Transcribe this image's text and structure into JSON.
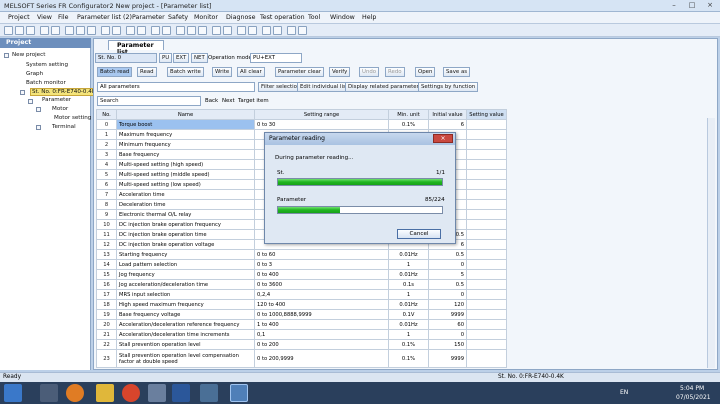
{
  "window": {
    "title": "MELSOFT Series FR Configurator2 New project - [Parameter list]"
  },
  "menu": [
    "Project",
    "View",
    "File",
    "Parameter list (2)",
    "Parameter",
    "Safety",
    "Monitor",
    "Diagnose",
    "Test operation",
    "Tool",
    "Window",
    "Help"
  ],
  "project_pane": {
    "title": "Project",
    "tree": [
      "New project",
      "System setting",
      "Graph",
      "Batch monitor",
      "St. No. 0:FR-E740-0.4K",
      "Parameter",
      "Motor",
      "Motor setting",
      "Terminal"
    ]
  },
  "param_window": {
    "tab": "Parameter list",
    "station": "St. No. 0",
    "mode_buttons": [
      "PU",
      "EXT",
      "NET"
    ],
    "operation_mode_label": "Operation mode",
    "operation_mode_value": "PU+EXT",
    "actions": [
      "Batch read",
      "Read",
      "Batch write",
      "Write",
      "All clear",
      "Parameter clear",
      "Verify",
      "Undo",
      "Redo",
      "Open",
      "Save as"
    ],
    "filter_value": "All parameters",
    "filter_buttons": [
      "Filter selection",
      "Edit individual list",
      "Display related parameters",
      "Settings by function"
    ],
    "search_button": "Search",
    "nav_buttons": [
      "Back",
      "Next",
      "Target item"
    ],
    "columns": [
      "No.",
      "Name",
      "Setting range",
      "Min. unit",
      "Initial value",
      "Setting value"
    ],
    "rows": [
      {
        "no": "0",
        "name": "Torque boost",
        "range": "0 to 30",
        "unit": "0.1%",
        "init": "6"
      },
      {
        "no": "1",
        "name": "Maximum frequency",
        "range": "",
        "unit": "",
        "init": ""
      },
      {
        "no": "2",
        "name": "Minimum frequency",
        "range": "",
        "unit": "",
        "init": ""
      },
      {
        "no": "3",
        "name": "Base frequency",
        "range": "",
        "unit": "",
        "init": ""
      },
      {
        "no": "4",
        "name": "Multi-speed setting (high speed)",
        "range": "",
        "unit": "",
        "init": ""
      },
      {
        "no": "5",
        "name": "Multi-speed setting (middle speed)",
        "range": "",
        "unit": "",
        "init": ""
      },
      {
        "no": "6",
        "name": "Multi-speed setting (low speed)",
        "range": "",
        "unit": "",
        "init": ""
      },
      {
        "no": "7",
        "name": "Acceleration time",
        "range": "",
        "unit": "",
        "init": ""
      },
      {
        "no": "8",
        "name": "Deceleration time",
        "range": "",
        "unit": "",
        "init": ""
      },
      {
        "no": "9",
        "name": "Electronic thermal O/L relay",
        "range": "",
        "unit": "",
        "init": ""
      },
      {
        "no": "10",
        "name": "DC injection brake operation frequency",
        "range": "",
        "unit": "",
        "init": ""
      },
      {
        "no": "11",
        "name": "DC injection brake operation time",
        "range": "",
        "unit": "",
        "init": "0.5"
      },
      {
        "no": "12",
        "name": "DC injection brake operation voltage",
        "range": "",
        "unit": "",
        "init": "6"
      },
      {
        "no": "13",
        "name": "Starting frequency",
        "range": "0 to 60",
        "unit": "0.01Hz",
        "init": "0.5"
      },
      {
        "no": "14",
        "name": "Load pattern selection",
        "range": "0 to 3",
        "unit": "1",
        "init": "0"
      },
      {
        "no": "15",
        "name": "Jog frequency",
        "range": "0 to 400",
        "unit": "0.01Hz",
        "init": "5"
      },
      {
        "no": "16",
        "name": "Jog acceleration/deceleration time",
        "range": "0 to 3600",
        "unit": "0.1s",
        "init": "0.5"
      },
      {
        "no": "17",
        "name": "MRS input selection",
        "range": "0,2,4",
        "unit": "1",
        "init": "0"
      },
      {
        "no": "18",
        "name": "High speed maximum frequency",
        "range": "120 to 400",
        "unit": "0.01Hz",
        "init": "120"
      },
      {
        "no": "19",
        "name": "Base frequency voltage",
        "range": "0 to 1000,8888,9999",
        "unit": "0.1V",
        "init": "9999"
      },
      {
        "no": "20",
        "name": "Acceleration/deceleration reference frequency",
        "range": "1 to 400",
        "unit": "0.01Hz",
        "init": "60"
      },
      {
        "no": "21",
        "name": "Acceleration/deceleration time increments",
        "range": "0,1",
        "unit": "1",
        "init": "0"
      },
      {
        "no": "22",
        "name": "Stall prevention operation level",
        "range": "0 to 200",
        "unit": "0.1%",
        "init": "150"
      },
      {
        "no": "23",
        "name": "Stall prevention operation level compensation factor at double speed",
        "range": "0 to 200,9999",
        "unit": "0.1%",
        "init": "9999"
      }
    ]
  },
  "dialog": {
    "title": "Parameter reading",
    "close": "×",
    "message": "During parameter reading...",
    "st_label": "St.",
    "st_count": "1/1",
    "st_progress": 1.0,
    "param_label": "Parameter",
    "param_count": "85/224",
    "param_progress": 0.379,
    "cancel": "Cancel"
  },
  "status": {
    "left": "Ready",
    "right": "St. No. 0:FR-E740-0.4K"
  },
  "taskbar": {
    "lang": "EN",
    "time": "5:04 PM",
    "date": "07/05/2021"
  }
}
